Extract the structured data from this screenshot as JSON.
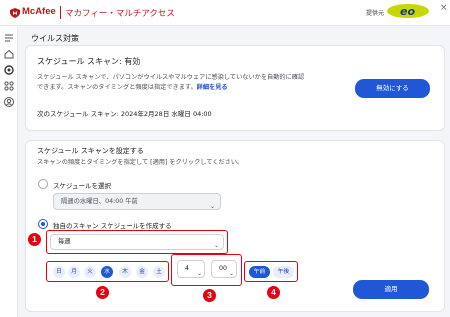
{
  "header": {
    "brand": "McAfee",
    "product": "マカフィー・マルチアクセス",
    "provider_label": "提供元",
    "provider_logo_text": "eo",
    "close_glyph": "×"
  },
  "sidebar": {
    "icons": [
      "menu-icon",
      "home-icon",
      "protection-icon",
      "apps-icon",
      "account-icon"
    ]
  },
  "page": {
    "title": "ウイルス対策"
  },
  "status_card": {
    "heading": "スケジュール スキャン: 有効",
    "description_line1": "スケジュール スキャンで、パソコンがウイルスやマルウェアに感染していないかを自動的に確認",
    "description_line2": "できます。スキャンのタイミングと頻度は指定できます。",
    "details_link": "詳細を見る",
    "next_scan": "次のスケジュール スキャン:  2024年2月28日 水曜日 04:00",
    "disable_button": "無効にする"
  },
  "settings_card": {
    "heading": "スケジュール スキャンを設定する",
    "description": "スキャンの頻度とタイミングを指定して [適用] をクリックしてください。",
    "option_preset_label": "スケジュールを選択",
    "preset_value": "隔週の水曜日、04:00 午前",
    "option_custom_label": "独自のスキャン スケジュールを作成する",
    "frequency_value": "毎週",
    "days": [
      {
        "label": "日",
        "selected": false
      },
      {
        "label": "月",
        "selected": false
      },
      {
        "label": "火",
        "selected": false
      },
      {
        "label": "水",
        "selected": true
      },
      {
        "label": "木",
        "selected": false
      },
      {
        "label": "金",
        "selected": false
      },
      {
        "label": "土",
        "selected": false
      }
    ],
    "hour_value": "4",
    "minute_value": "00",
    "am_label": "午前",
    "pm_label": "午後",
    "apply_button": "適用"
  },
  "annotations": [
    "1",
    "2",
    "3",
    "4"
  ],
  "colors": {
    "accent": "#1f57d6",
    "brand_red": "#c01818",
    "annotation_red": "#e60012"
  }
}
